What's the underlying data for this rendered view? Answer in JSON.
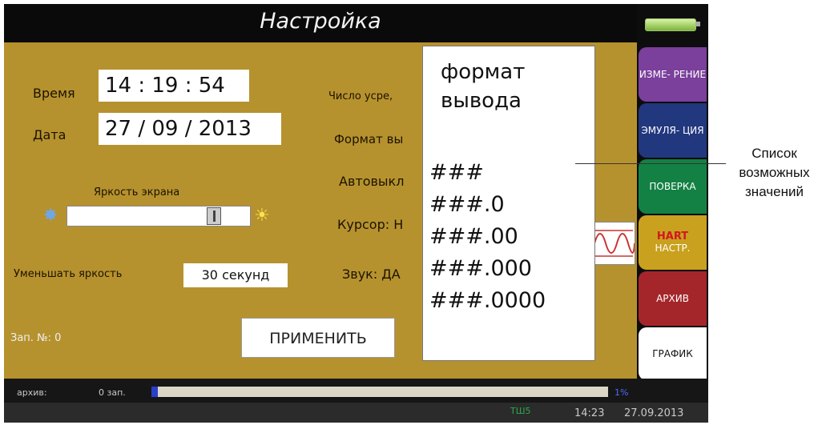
{
  "title": "Настройка",
  "settings": {
    "time_label": "Время",
    "time_value": "14 : 19 : 54",
    "date_label": "Дата",
    "date_value": "27 / 09 / 2013",
    "brightness_label": "Яркость экрана",
    "brightness_level": 0.85,
    "dim_label": "Уменьшать яркость",
    "dim_value": "30 секунд",
    "record_no": "Зап. №: 0",
    "apply_label": "ПРИМЕНИТЬ"
  },
  "fields": {
    "averaging": "Число усре,",
    "output_format": "Формат вы",
    "auto_off": "Автовыкл",
    "cursor": "Курсор: Н",
    "sound": "Звук: ДА"
  },
  "popup": {
    "title": "формат вывода",
    "options": [
      "###",
      "###.0",
      "###.00",
      "###.000",
      "###.0000"
    ]
  },
  "tabs": {
    "measure": "ИЗМЕ- РЕНИЕ",
    "emulation": "ЭМУЛЯ- ЦИЯ",
    "calibration": "ПОВЕРКА",
    "hart_brand": "HART",
    "hart": "НАСТР.",
    "archive": "АРХИВ",
    "chart": "ГРАФИК"
  },
  "status": {
    "archive_label": "архив:",
    "records": "0 зап.",
    "archive_fill": 0.012,
    "percent": "1%",
    "mode": "ТШ5",
    "time": "14:23",
    "date": "27.09.2013"
  },
  "annotation": "Список возможных значений"
}
